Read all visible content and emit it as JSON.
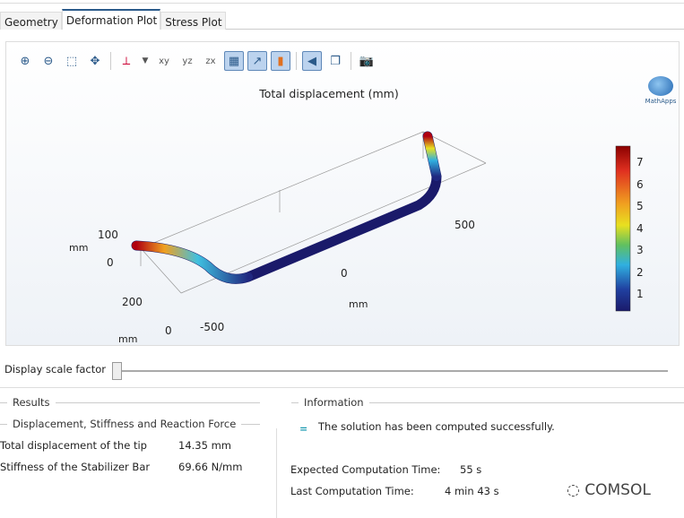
{
  "tabs": [
    {
      "label": "Geometry"
    },
    {
      "label": "Deformation Plot",
      "active": true
    },
    {
      "label": "Stress Plot"
    }
  ],
  "toolbar": [
    "zoom-in-icon",
    "zoom-out-icon",
    "zoom-box-icon",
    "zoom-extents-icon",
    "axis-orientation-icon",
    "dropdown-icon",
    "view-xy-icon",
    "view-yz-icon",
    "view-zx-icon",
    "grid-icon",
    "axis-icon",
    "color-legend-icon",
    "lighting-icon",
    "transparency-icon",
    "camera-icon"
  ],
  "plot": {
    "title": "Total displacement (mm)",
    "logo": "MathApps",
    "legend_ticks": [
      "7",
      "6",
      "5",
      "4",
      "3",
      "2",
      "1"
    ],
    "colormap": [
      "#8b0000",
      "#e03020",
      "#f0a020",
      "#e8e020",
      "#60c060",
      "#30b0e0",
      "#2040a0",
      "#1a1a6a"
    ],
    "axis_labels": {
      "z_ticks": [
        "100",
        "0"
      ],
      "z_unit": "mm",
      "y_ticks": [
        "200",
        "0"
      ],
      "y_unit": "mm",
      "x_ticks": [
        "-500",
        "0",
        "500"
      ],
      "x_unit": "mm"
    }
  },
  "scale_factor": {
    "label": "Display scale factor",
    "value": 0
  },
  "results": {
    "title": "Results",
    "subtitle": "Displacement, Stiffness and Reaction Force",
    "rows": [
      {
        "label": "Total displacement of the tip",
        "value": "14.35 mm"
      },
      {
        "label": "Stiffness of the Stabilizer Bar",
        "value": "69.66 N/mm"
      }
    ]
  },
  "information": {
    "title": "Information",
    "message": "The solution has been computed successfully.",
    "expected_label": "Expected Computation Time:",
    "expected_value": "55 s",
    "last_label": "Last Computation Time:",
    "last_value": "4 min 43 s"
  },
  "watermark": "COMSOL"
}
